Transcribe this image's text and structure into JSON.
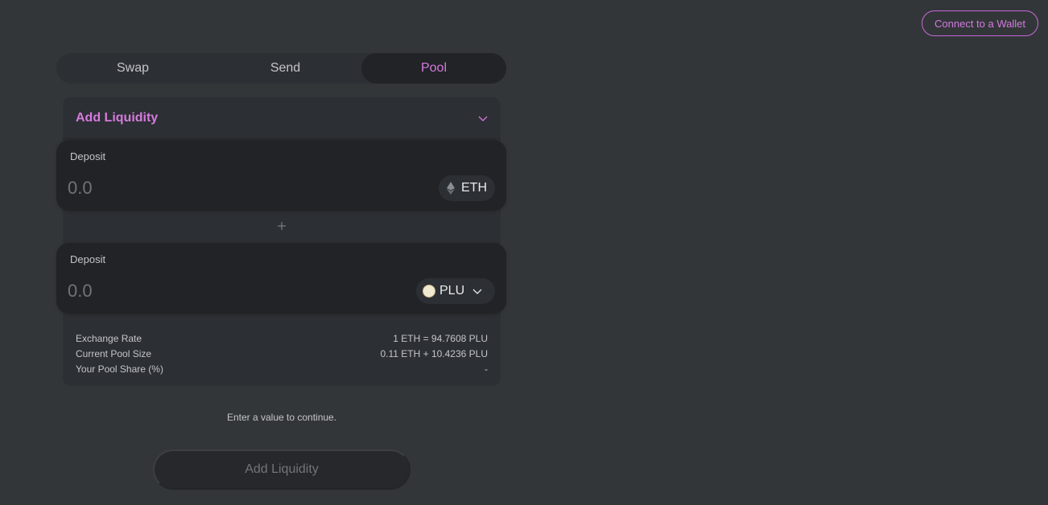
{
  "header": {
    "connect_wallet_label": "Connect to a Wallet"
  },
  "tabs": [
    {
      "label": "Swap",
      "active": false
    },
    {
      "label": "Send",
      "active": false
    },
    {
      "label": "Pool",
      "active": true
    }
  ],
  "panel": {
    "title": "Add Liquidity",
    "accent": "#d67adf"
  },
  "deposits": [
    {
      "label": "Deposit",
      "placeholder": "0.0",
      "token": "ETH",
      "token_icon": "eth-icon",
      "has_dropdown": false
    },
    {
      "label": "Deposit",
      "placeholder": "0.0",
      "token": "PLU",
      "token_icon": "plu-icon",
      "has_dropdown": true
    }
  ],
  "info": [
    {
      "label": "Exchange Rate",
      "value": "1 ETH = 94.7608 PLU"
    },
    {
      "label": "Current Pool Size",
      "value": "0.11 ETH + 10.4236 PLU"
    },
    {
      "label": "Your Pool Share (%)",
      "value": "-"
    }
  ],
  "status_text": "Enter a value to continue.",
  "submit_label": "Add Liquidity"
}
